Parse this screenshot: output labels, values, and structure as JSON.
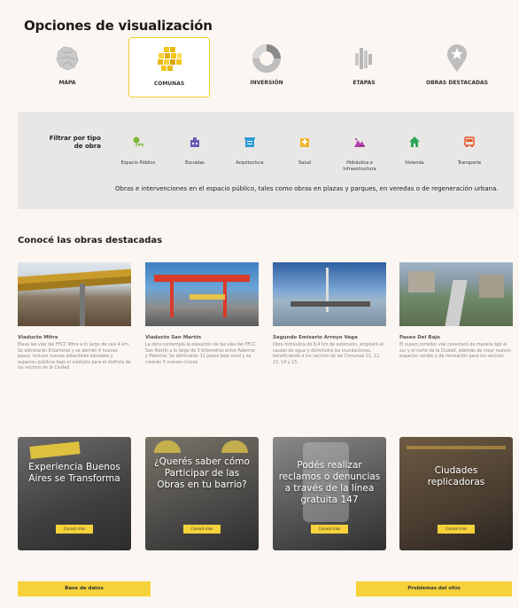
{
  "page_title": "Opciones de visualización",
  "viz_tabs": [
    {
      "label": "MAPA",
      "icon": "map-icon"
    },
    {
      "label": "COMUNAS",
      "icon": "comunas-grid-icon",
      "active": true
    },
    {
      "label": "INVERSIÓN",
      "icon": "donut-chart-icon"
    },
    {
      "label": "ETAPAS",
      "icon": "bars-icon"
    },
    {
      "label": "OBRAS DESTACADAS",
      "icon": "star-pin-icon"
    }
  ],
  "filter": {
    "title": "Filtrar por tipo de obra",
    "items": [
      {
        "label": "Espacio Público",
        "color": "#7fb73a"
      },
      {
        "label": "Escuelas",
        "color": "#6a5bb3"
      },
      {
        "label": "Arquitectura",
        "color": "#2d9ad8"
      },
      {
        "label": "Salud",
        "color": "#f2b531"
      },
      {
        "label": "Hidráulica e Infraestructura",
        "color": "#b344a8"
      },
      {
        "label": "Vivienda",
        "color": "#2fa65a"
      },
      {
        "label": "Transporte",
        "color": "#e8542b"
      }
    ],
    "description": "Obras e intervenciones en el espacio público, tales como obras en plazas y parques, en veredas o de regeneración urbana."
  },
  "featured_title": "Conocé las obras destacadas",
  "featured": [
    {
      "title": "Viaducto Mitre",
      "desc": "Eleva las vías del FFCC Mitre a lo largo de casi 4 km. Se eliminarán 8 barreras y se abrirán 4 nuevos pasos. Incluye nuevas estaciones elevadas y espacios públicos bajo el viaducto para el disfrute de los vecinos de la Ciudad."
    },
    {
      "title": "Viaducto San Martín",
      "desc": "La obra contempla la elevación de las vías del FFCC San Martín a lo largo de 5 kilómetros entre Palermo y Paternal. Se eliminarán 11 pasos bajo nivel y se crearán 5 nuevos cruces."
    },
    {
      "title": "Segundo Emisario Arroyo Vega",
      "desc": "Obra hidráulica de 8,4 km de extensión, ampliará el caudal de agua y disminuirá las inundaciones, beneficiando a los vecinos de las Comunas 11, 12, 13, 14 y 15."
    },
    {
      "title": "Paseo Del Bajo",
      "desc": "El nuevo corredor vial conectará de manera ágil el sur y el norte de la Ciudad, además de crear nuevos espacios verdes y de recreación para los vecinos."
    }
  ],
  "promos": [
    {
      "text": "Experiencia Buenos Aires se Transforma",
      "btn": "Conocé más"
    },
    {
      "text": "¿Querés saber cómo Participar de las Obras en tu barrio?",
      "btn": "Conocé más"
    },
    {
      "text": "Podés realizar reclamos o denuncias a través de la línea gratuita 147",
      "btn": "Conocé más"
    },
    {
      "text": "Ciudades replicadoras",
      "btn": "Conocé más"
    }
  ],
  "bottom": {
    "left": "Base de datos",
    "right": "Problemas del sitio"
  }
}
